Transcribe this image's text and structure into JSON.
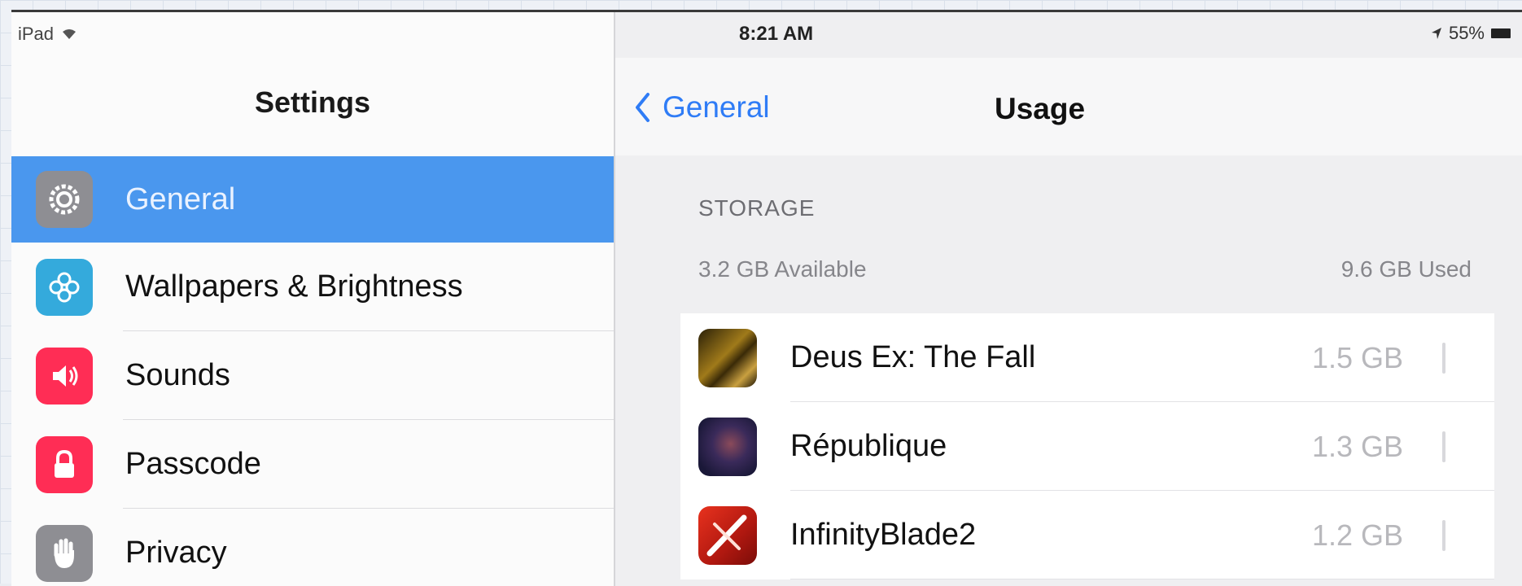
{
  "status_bar": {
    "device": "iPad",
    "time": "8:21 AM",
    "battery": "55%"
  },
  "sidebar": {
    "title": "Settings",
    "items": [
      {
        "label": "General",
        "icon": "gear-icon",
        "color": "#8e8e93",
        "selected": true
      },
      {
        "label": "Wallpapers & Brightness",
        "icon": "flower-icon",
        "color": "#34aadc",
        "selected": false
      },
      {
        "label": "Sounds",
        "icon": "speaker-icon",
        "color": "#ff2d55",
        "selected": false
      },
      {
        "label": "Passcode",
        "icon": "lock-icon",
        "color": "#ff2d55",
        "selected": false
      },
      {
        "label": "Privacy",
        "icon": "hand-icon",
        "color": "#8e8e93",
        "selected": false
      }
    ]
  },
  "detail": {
    "back_label": "General",
    "title": "Usage",
    "section_header": "STORAGE",
    "available": "3.2 GB Available",
    "used": "9.6 GB Used",
    "apps": [
      {
        "name": "Deus Ex: The Fall",
        "size": "1.5 GB"
      },
      {
        "name": "République",
        "size": "1.3 GB"
      },
      {
        "name": "InfinityBlade2",
        "size": "1.2 GB"
      }
    ]
  },
  "colors": {
    "accent": "#4a97ee",
    "link": "#2f7cf6"
  }
}
